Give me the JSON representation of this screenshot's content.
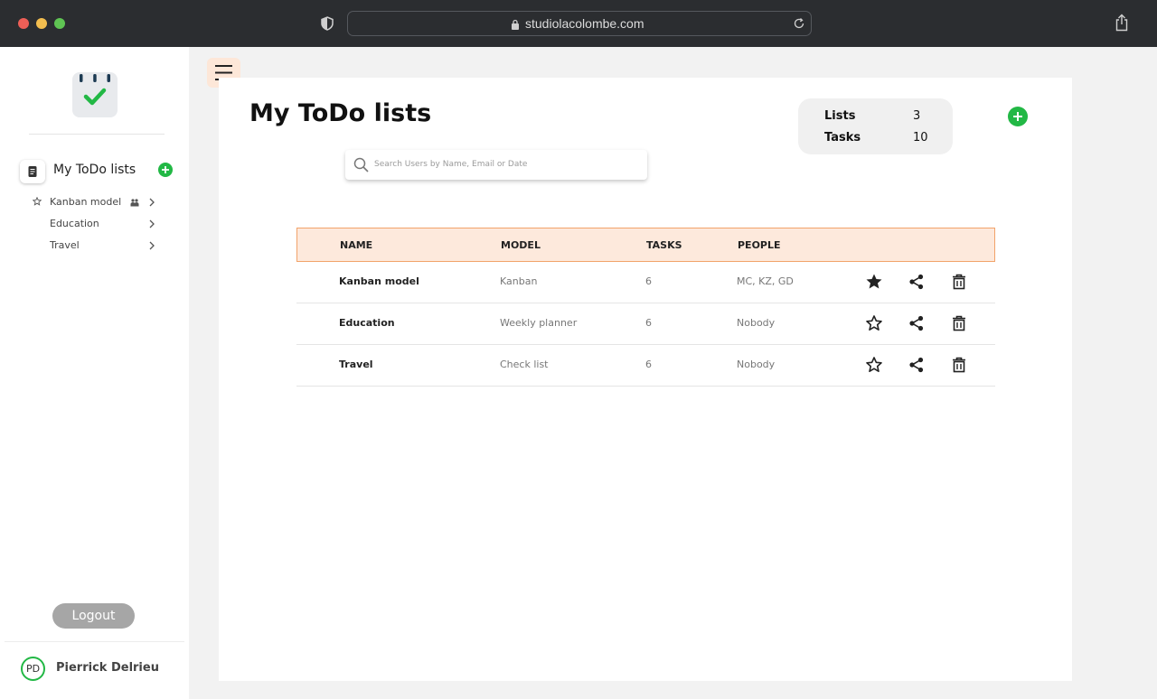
{
  "browser": {
    "url": "studiolacolombe.com"
  },
  "sidebar": {
    "main_item": "My ToDo lists",
    "lists": [
      {
        "label": "Kanban model",
        "starred": true,
        "shared": true
      },
      {
        "label": "Education",
        "starred": false,
        "shared": false
      },
      {
        "label": "Travel",
        "starred": false,
        "shared": false
      }
    ],
    "logout_label": "Logout",
    "user": {
      "initials": "PD",
      "name": "Pierrick Delrieu"
    }
  },
  "main": {
    "title": "My ToDo lists",
    "search_placeholder": "Search Users by Name, Email or Date",
    "stats": {
      "lists_label": "Lists",
      "lists_value": "3",
      "tasks_label": "Tasks",
      "tasks_value": "10"
    },
    "table": {
      "headers": [
        "NAME",
        "MODEL",
        "TASKS",
        "PEOPLE"
      ],
      "rows": [
        {
          "name": "Kanban model",
          "model": "Kanban",
          "tasks": "6",
          "people": "MC, KZ, GD",
          "favorite": true
        },
        {
          "name": "Education",
          "model": "Weekly planner",
          "tasks": "6",
          "people": "Nobody",
          "favorite": false
        },
        {
          "name": "Travel",
          "model": "Check list",
          "tasks": "6",
          "people": "Nobody",
          "favorite": false
        }
      ]
    }
  },
  "colors": {
    "accent_green": "#22b845",
    "header_bg": "#fde9dc",
    "header_border": "#f2a36a"
  }
}
